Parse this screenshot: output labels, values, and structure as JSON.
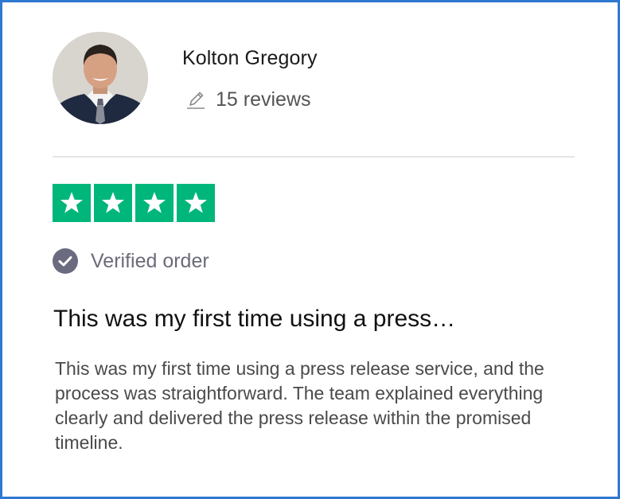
{
  "reviewer": {
    "name": "Kolton Gregory",
    "review_count": "15 reviews"
  },
  "rating": {
    "stars": 4,
    "max_stars": 4,
    "color": "#00b67a"
  },
  "verification": {
    "label": "Verified order"
  },
  "review": {
    "title": "This was my first time using a press…",
    "body": "This was my first time using a press release service, and the process was straightforward. The team explained everything clearly and delivered the press release within the promised timeline."
  },
  "theme": {
    "border_color": "#2f78d1",
    "star_color": "#00b67a"
  }
}
